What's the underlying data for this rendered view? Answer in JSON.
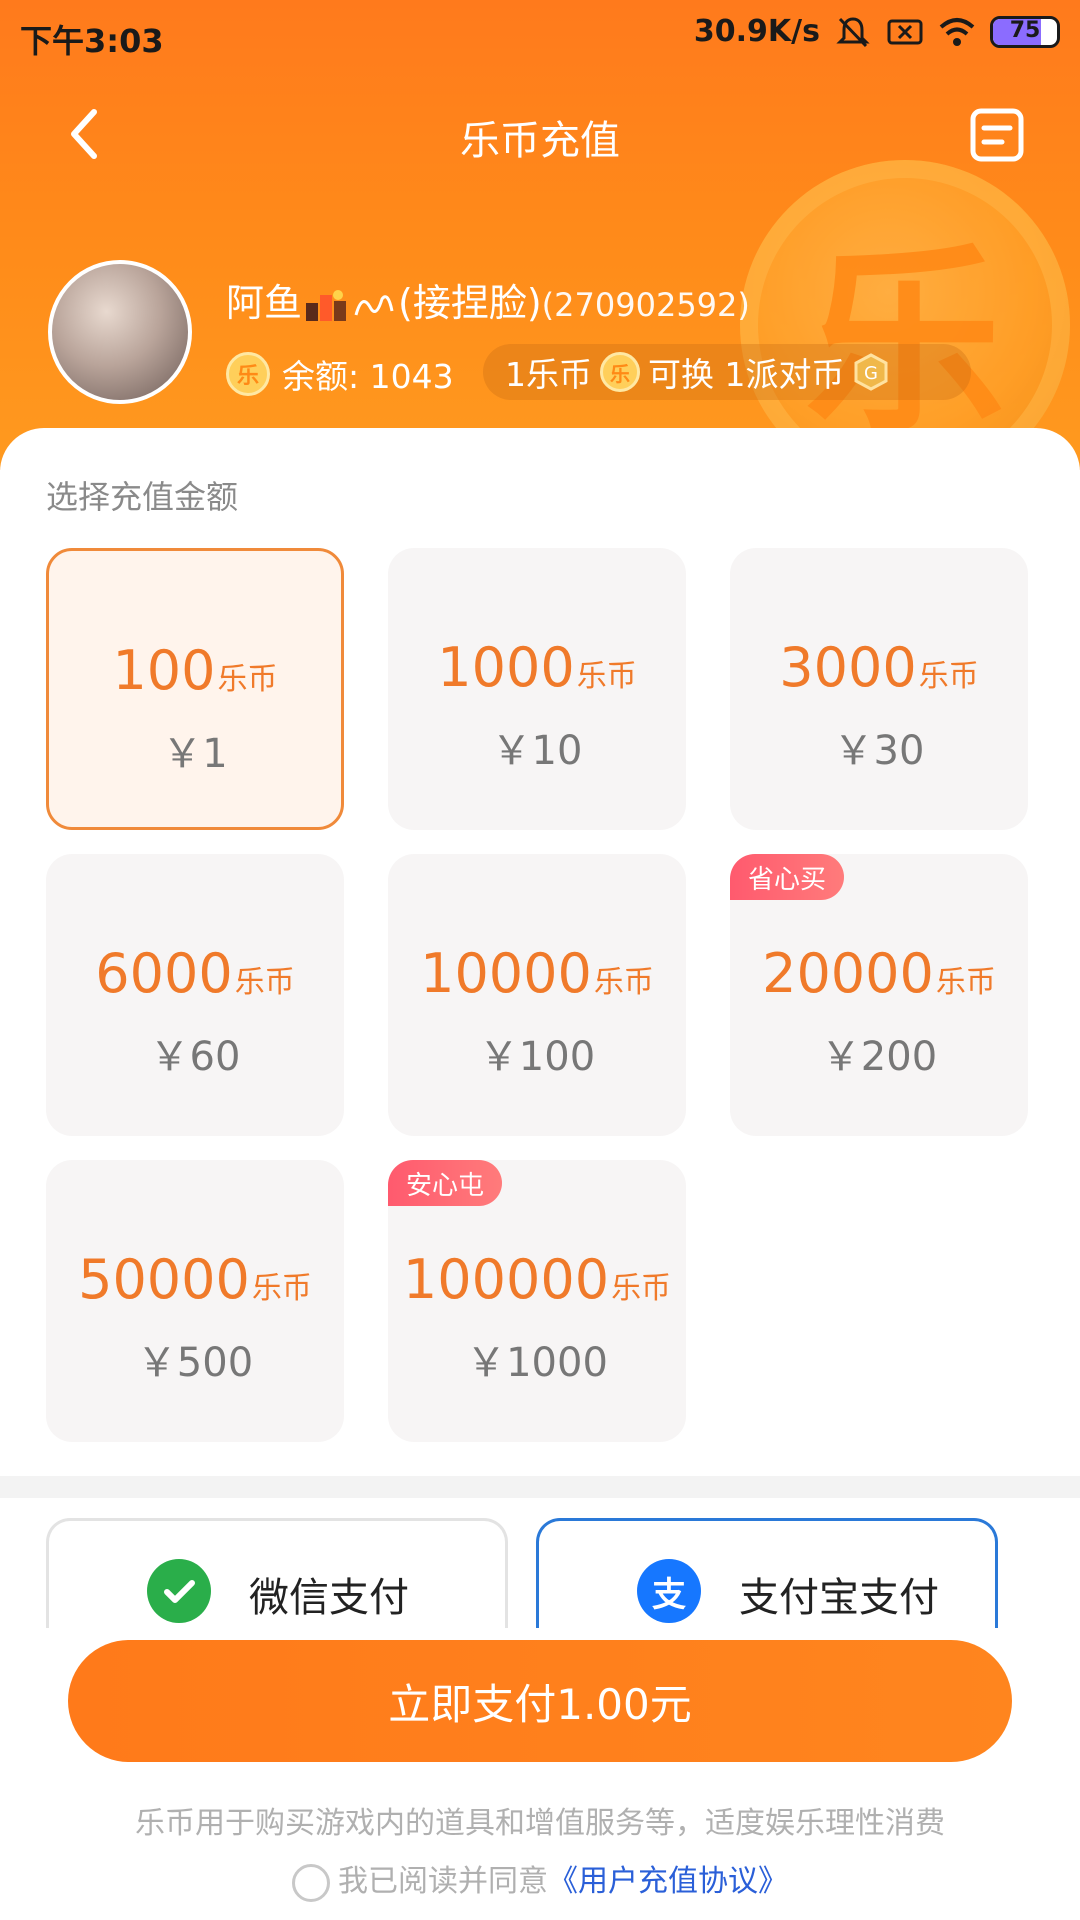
{
  "status_bar": {
    "time": "下午3:03",
    "network_speed": "30.9K/s",
    "battery_percent": 75,
    "battery_label": "75"
  },
  "nav": {
    "title": "乐币充值",
    "back_icon": "chevron-left-icon",
    "menu_icon": "document-list-icon"
  },
  "profile": {
    "name": "阿鱼",
    "name_suffix": "(接捏脸)",
    "uid": "(270902592)",
    "balance_label": "余额: 1043",
    "exchange_prefix": "1乐币",
    "exchange_middle": "可换 1派对币",
    "coin_char": "乐"
  },
  "section_title": "选择充值金额",
  "unit": "乐币",
  "options": [
    {
      "amount": "100",
      "price": "￥1",
      "selected": true
    },
    {
      "amount": "1000",
      "price": "￥10"
    },
    {
      "amount": "3000",
      "price": "￥30"
    },
    {
      "amount": "6000",
      "price": "￥60"
    },
    {
      "amount": "10000",
      "price": "￥100"
    },
    {
      "amount": "20000",
      "price": "￥200",
      "badge": "省心买"
    },
    {
      "amount": "50000",
      "price": "￥500"
    },
    {
      "amount": "100000",
      "price": "￥1000",
      "badge": "安心屯"
    }
  ],
  "payment_methods": [
    {
      "label": "微信支付",
      "icon": "wechat-pay-icon",
      "color": "#2aae4a",
      "active": false
    },
    {
      "label": "支付宝支付",
      "icon": "alipay-icon",
      "color": "#1677ff",
      "active": true
    }
  ],
  "pay_button": "立即支付1.00元",
  "disclaimer": "乐币用于购买游戏内的道具和增值服务等，适度娱乐理性消费",
  "agreement": {
    "prefix": "我已阅读并同意",
    "link": "《用户充值协议》"
  },
  "colors": {
    "accent": "#ff7a1a",
    "amount_text": "#f07a2a",
    "badge": "#ff5a6e",
    "link": "#2a5fd8"
  }
}
